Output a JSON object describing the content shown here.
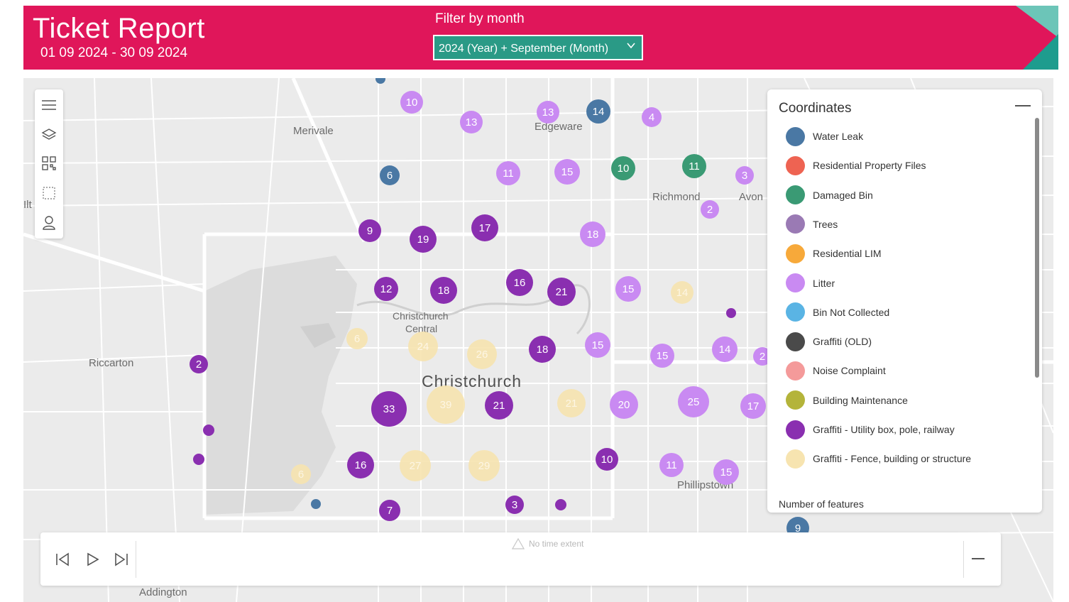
{
  "header": {
    "title": "Ticket Report",
    "date_range": "01 09 2024 - 30 09 2024",
    "filter_label": "Filter by month",
    "filter_value": "2024 (Year) + September (Month)",
    "accent": "#e0165a",
    "slicer_color": "#2a9a86"
  },
  "map": {
    "places": {
      "merivale": "Merivale",
      "edgeware": "Edgeware",
      "richmond": "Richmond",
      "avon": "Avon",
      "christchurch_central_1": "Christchurch",
      "christchurch_central_2": "Central",
      "christchurch": "Christchurch",
      "riccarton": "Riccarton",
      "phillipstown": "Phillipstown",
      "addington": "Addington",
      "ilam_partial": "Ilt"
    },
    "toolbar": [
      "menu-icon",
      "layers-icon",
      "qr-grid-icon",
      "select-rectangle-icon",
      "person-icon"
    ],
    "markers": [
      {
        "label": "10",
        "category": "Litter"
      },
      {
        "label": "13",
        "category": "Litter"
      },
      {
        "label": "13",
        "category": "Litter"
      },
      {
        "label": "14",
        "category": "Water Leak"
      },
      {
        "label": "4",
        "category": "Litter"
      },
      {
        "label": "6",
        "category": "Water Leak"
      },
      {
        "label": "11",
        "category": "Litter"
      },
      {
        "label": "15",
        "category": "Litter"
      },
      {
        "label": "10",
        "category": "Damaged Bin"
      },
      {
        "label": "11",
        "category": "Damaged Bin"
      },
      {
        "label": "3",
        "category": "Litter"
      },
      {
        "label": "2",
        "category": "Litter"
      },
      {
        "label": "9",
        "category": "Graffiti - Utility box, pole, railway"
      },
      {
        "label": "19",
        "category": "Graffiti - Utility box, pole, railway"
      },
      {
        "label": "17",
        "category": "Graffiti - Utility box, pole, railway"
      },
      {
        "label": "18",
        "category": "Litter"
      },
      {
        "label": "12",
        "category": "Graffiti - Utility box, pole, railway"
      },
      {
        "label": "18",
        "category": "Graffiti - Utility box, pole, railway"
      },
      {
        "label": "16",
        "category": "Graffiti - Utility box, pole, railway"
      },
      {
        "label": "21",
        "category": "Graffiti - Utility box, pole, railway"
      },
      {
        "label": "15",
        "category": "Litter"
      },
      {
        "label": "14",
        "category": "Graffiti - Fence, building or structure"
      },
      {
        "label": "6",
        "category": "Graffiti - Fence, building or structure"
      },
      {
        "label": "24",
        "category": "Graffiti - Fence, building or structure"
      },
      {
        "label": "26",
        "category": "Graffiti - Fence, building or structure"
      },
      {
        "label": "18",
        "category": "Graffiti - Utility box, pole, railway"
      },
      {
        "label": "15",
        "category": "Litter"
      },
      {
        "label": "15",
        "category": "Litter"
      },
      {
        "label": "14",
        "category": "Litter"
      },
      {
        "label": "2",
        "category": "Graffiti - Utility box, pole, railway"
      },
      {
        "label": "33",
        "category": "Graffiti - Utility box, pole, railway"
      },
      {
        "label": "39",
        "category": "Graffiti - Fence, building or structure"
      },
      {
        "label": "21",
        "category": "Graffiti - Utility box, pole, railway"
      },
      {
        "label": "21",
        "category": "Graffiti - Fence, building or structure"
      },
      {
        "label": "20",
        "category": "Litter"
      },
      {
        "label": "25",
        "category": "Litter"
      },
      {
        "label": "17",
        "category": "Litter"
      },
      {
        "label": "16",
        "category": "Graffiti - Utility box, pole, railway"
      },
      {
        "label": "27",
        "category": "Graffiti - Fence, building or structure"
      },
      {
        "label": "29",
        "category": "Graffiti - Fence, building or structure"
      },
      {
        "label": "10",
        "category": "Graffiti - Utility box, pole, railway"
      },
      {
        "label": "11",
        "category": "Litter"
      },
      {
        "label": "15",
        "category": "Litter"
      },
      {
        "label": "6",
        "category": "Graffiti - Fence, building or structure"
      },
      {
        "label": "7",
        "category": "Graffiti - Utility box, pole, railway"
      },
      {
        "label": "3",
        "category": "Graffiti - Utility box, pole, railway"
      },
      {
        "label": "",
        "category": "Graffiti - Utility box, pole, railway"
      },
      {
        "label": "",
        "category": "Graffiti - Utility box, pole, railway"
      },
      {
        "label": "",
        "category": "Graffiti - Utility box, pole, railway"
      },
      {
        "label": "",
        "category": "Graffiti - Utility box, pole, railway"
      },
      {
        "label": "",
        "category": "Water Leak"
      },
      {
        "label": "",
        "category": "Water Leak"
      },
      {
        "label": "2",
        "category": "Litter"
      },
      {
        "label": "9",
        "category": "Water Leak"
      }
    ]
  },
  "legend": {
    "title": "Coordinates",
    "subtitle": "Number of features",
    "items": [
      {
        "label": "Water Leak",
        "color": "#4a78a4"
      },
      {
        "label": "Residential Property Files",
        "color": "#ee6352"
      },
      {
        "label": "Damaged Bin",
        "color": "#3a9a74"
      },
      {
        "label": "Trees",
        "color": "#9a7ab4"
      },
      {
        "label": "Residential LIM",
        "color": "#f7a93a"
      },
      {
        "label": "Litter",
        "color": "#c98af2"
      },
      {
        "label": "Bin Not Collected",
        "color": "#5ab4e4"
      },
      {
        "label": "Graffiti (OLD)",
        "color": "#4a4a4a"
      },
      {
        "label": "Noise Complaint",
        "color": "#f49a9a"
      },
      {
        "label": "Building Maintenance",
        "color": "#b4b43a"
      },
      {
        "label": "Graffiti - Utility box, pole, railway",
        "color": "#8a2fb0"
      },
      {
        "label": "Graffiti - Fence, building or structure",
        "color": "#f7e4b0"
      }
    ]
  },
  "timebar": {
    "message": "No time extent"
  }
}
